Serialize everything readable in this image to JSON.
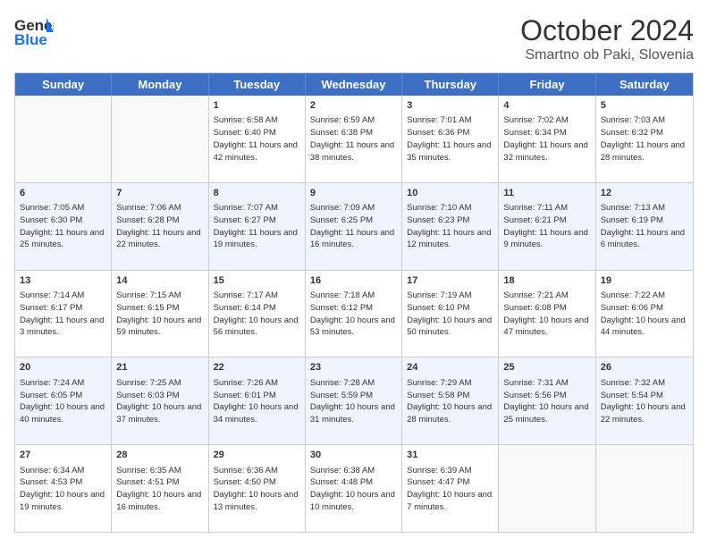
{
  "header": {
    "logo_line1": "General",
    "logo_line2": "Blue",
    "title": "October 2024",
    "subtitle": "Smartno ob Paki, Slovenia"
  },
  "days_of_week": [
    "Sunday",
    "Monday",
    "Tuesday",
    "Wednesday",
    "Thursday",
    "Friday",
    "Saturday"
  ],
  "weeks": [
    [
      {
        "num": "",
        "sunrise": "",
        "sunset": "",
        "daylight": "",
        "empty": true
      },
      {
        "num": "",
        "sunrise": "",
        "sunset": "",
        "daylight": "",
        "empty": true
      },
      {
        "num": "1",
        "sunrise": "Sunrise: 6:58 AM",
        "sunset": "Sunset: 6:40 PM",
        "daylight": "Daylight: 11 hours and 42 minutes.",
        "empty": false
      },
      {
        "num": "2",
        "sunrise": "Sunrise: 6:59 AM",
        "sunset": "Sunset: 6:38 PM",
        "daylight": "Daylight: 11 hours and 38 minutes.",
        "empty": false
      },
      {
        "num": "3",
        "sunrise": "Sunrise: 7:01 AM",
        "sunset": "Sunset: 6:36 PM",
        "daylight": "Daylight: 11 hours and 35 minutes.",
        "empty": false
      },
      {
        "num": "4",
        "sunrise": "Sunrise: 7:02 AM",
        "sunset": "Sunset: 6:34 PM",
        "daylight": "Daylight: 11 hours and 32 minutes.",
        "empty": false
      },
      {
        "num": "5",
        "sunrise": "Sunrise: 7:03 AM",
        "sunset": "Sunset: 6:32 PM",
        "daylight": "Daylight: 11 hours and 28 minutes.",
        "empty": false
      }
    ],
    [
      {
        "num": "6",
        "sunrise": "Sunrise: 7:05 AM",
        "sunset": "Sunset: 6:30 PM",
        "daylight": "Daylight: 11 hours and 25 minutes.",
        "empty": false
      },
      {
        "num": "7",
        "sunrise": "Sunrise: 7:06 AM",
        "sunset": "Sunset: 6:28 PM",
        "daylight": "Daylight: 11 hours and 22 minutes.",
        "empty": false
      },
      {
        "num": "8",
        "sunrise": "Sunrise: 7:07 AM",
        "sunset": "Sunset: 6:27 PM",
        "daylight": "Daylight: 11 hours and 19 minutes.",
        "empty": false
      },
      {
        "num": "9",
        "sunrise": "Sunrise: 7:09 AM",
        "sunset": "Sunset: 6:25 PM",
        "daylight": "Daylight: 11 hours and 16 minutes.",
        "empty": false
      },
      {
        "num": "10",
        "sunrise": "Sunrise: 7:10 AM",
        "sunset": "Sunset: 6:23 PM",
        "daylight": "Daylight: 11 hours and 12 minutes.",
        "empty": false
      },
      {
        "num": "11",
        "sunrise": "Sunrise: 7:11 AM",
        "sunset": "Sunset: 6:21 PM",
        "daylight": "Daylight: 11 hours and 9 minutes.",
        "empty": false
      },
      {
        "num": "12",
        "sunrise": "Sunrise: 7:13 AM",
        "sunset": "Sunset: 6:19 PM",
        "daylight": "Daylight: 11 hours and 6 minutes.",
        "empty": false
      }
    ],
    [
      {
        "num": "13",
        "sunrise": "Sunrise: 7:14 AM",
        "sunset": "Sunset: 6:17 PM",
        "daylight": "Daylight: 11 hours and 3 minutes.",
        "empty": false
      },
      {
        "num": "14",
        "sunrise": "Sunrise: 7:15 AM",
        "sunset": "Sunset: 6:15 PM",
        "daylight": "Daylight: 10 hours and 59 minutes.",
        "empty": false
      },
      {
        "num": "15",
        "sunrise": "Sunrise: 7:17 AM",
        "sunset": "Sunset: 6:14 PM",
        "daylight": "Daylight: 10 hours and 56 minutes.",
        "empty": false
      },
      {
        "num": "16",
        "sunrise": "Sunrise: 7:18 AM",
        "sunset": "Sunset: 6:12 PM",
        "daylight": "Daylight: 10 hours and 53 minutes.",
        "empty": false
      },
      {
        "num": "17",
        "sunrise": "Sunrise: 7:19 AM",
        "sunset": "Sunset: 6:10 PM",
        "daylight": "Daylight: 10 hours and 50 minutes.",
        "empty": false
      },
      {
        "num": "18",
        "sunrise": "Sunrise: 7:21 AM",
        "sunset": "Sunset: 6:08 PM",
        "daylight": "Daylight: 10 hours and 47 minutes.",
        "empty": false
      },
      {
        "num": "19",
        "sunrise": "Sunrise: 7:22 AM",
        "sunset": "Sunset: 6:06 PM",
        "daylight": "Daylight: 10 hours and 44 minutes.",
        "empty": false
      }
    ],
    [
      {
        "num": "20",
        "sunrise": "Sunrise: 7:24 AM",
        "sunset": "Sunset: 6:05 PM",
        "daylight": "Daylight: 10 hours and 40 minutes.",
        "empty": false
      },
      {
        "num": "21",
        "sunrise": "Sunrise: 7:25 AM",
        "sunset": "Sunset: 6:03 PM",
        "daylight": "Daylight: 10 hours and 37 minutes.",
        "empty": false
      },
      {
        "num": "22",
        "sunrise": "Sunrise: 7:26 AM",
        "sunset": "Sunset: 6:01 PM",
        "daylight": "Daylight: 10 hours and 34 minutes.",
        "empty": false
      },
      {
        "num": "23",
        "sunrise": "Sunrise: 7:28 AM",
        "sunset": "Sunset: 5:59 PM",
        "daylight": "Daylight: 10 hours and 31 minutes.",
        "empty": false
      },
      {
        "num": "24",
        "sunrise": "Sunrise: 7:29 AM",
        "sunset": "Sunset: 5:58 PM",
        "daylight": "Daylight: 10 hours and 28 minutes.",
        "empty": false
      },
      {
        "num": "25",
        "sunrise": "Sunrise: 7:31 AM",
        "sunset": "Sunset: 5:56 PM",
        "daylight": "Daylight: 10 hours and 25 minutes.",
        "empty": false
      },
      {
        "num": "26",
        "sunrise": "Sunrise: 7:32 AM",
        "sunset": "Sunset: 5:54 PM",
        "daylight": "Daylight: 10 hours and 22 minutes.",
        "empty": false
      }
    ],
    [
      {
        "num": "27",
        "sunrise": "Sunrise: 6:34 AM",
        "sunset": "Sunset: 4:53 PM",
        "daylight": "Daylight: 10 hours and 19 minutes.",
        "empty": false
      },
      {
        "num": "28",
        "sunrise": "Sunrise: 6:35 AM",
        "sunset": "Sunset: 4:51 PM",
        "daylight": "Daylight: 10 hours and 16 minutes.",
        "empty": false
      },
      {
        "num": "29",
        "sunrise": "Sunrise: 6:36 AM",
        "sunset": "Sunset: 4:50 PM",
        "daylight": "Daylight: 10 hours and 13 minutes.",
        "empty": false
      },
      {
        "num": "30",
        "sunrise": "Sunrise: 6:38 AM",
        "sunset": "Sunset: 4:48 PM",
        "daylight": "Daylight: 10 hours and 10 minutes.",
        "empty": false
      },
      {
        "num": "31",
        "sunrise": "Sunrise: 6:39 AM",
        "sunset": "Sunset: 4:47 PM",
        "daylight": "Daylight: 10 hours and 7 minutes.",
        "empty": false
      },
      {
        "num": "",
        "sunrise": "",
        "sunset": "",
        "daylight": "",
        "empty": true
      },
      {
        "num": "",
        "sunrise": "",
        "sunset": "",
        "daylight": "",
        "empty": true
      }
    ]
  ]
}
